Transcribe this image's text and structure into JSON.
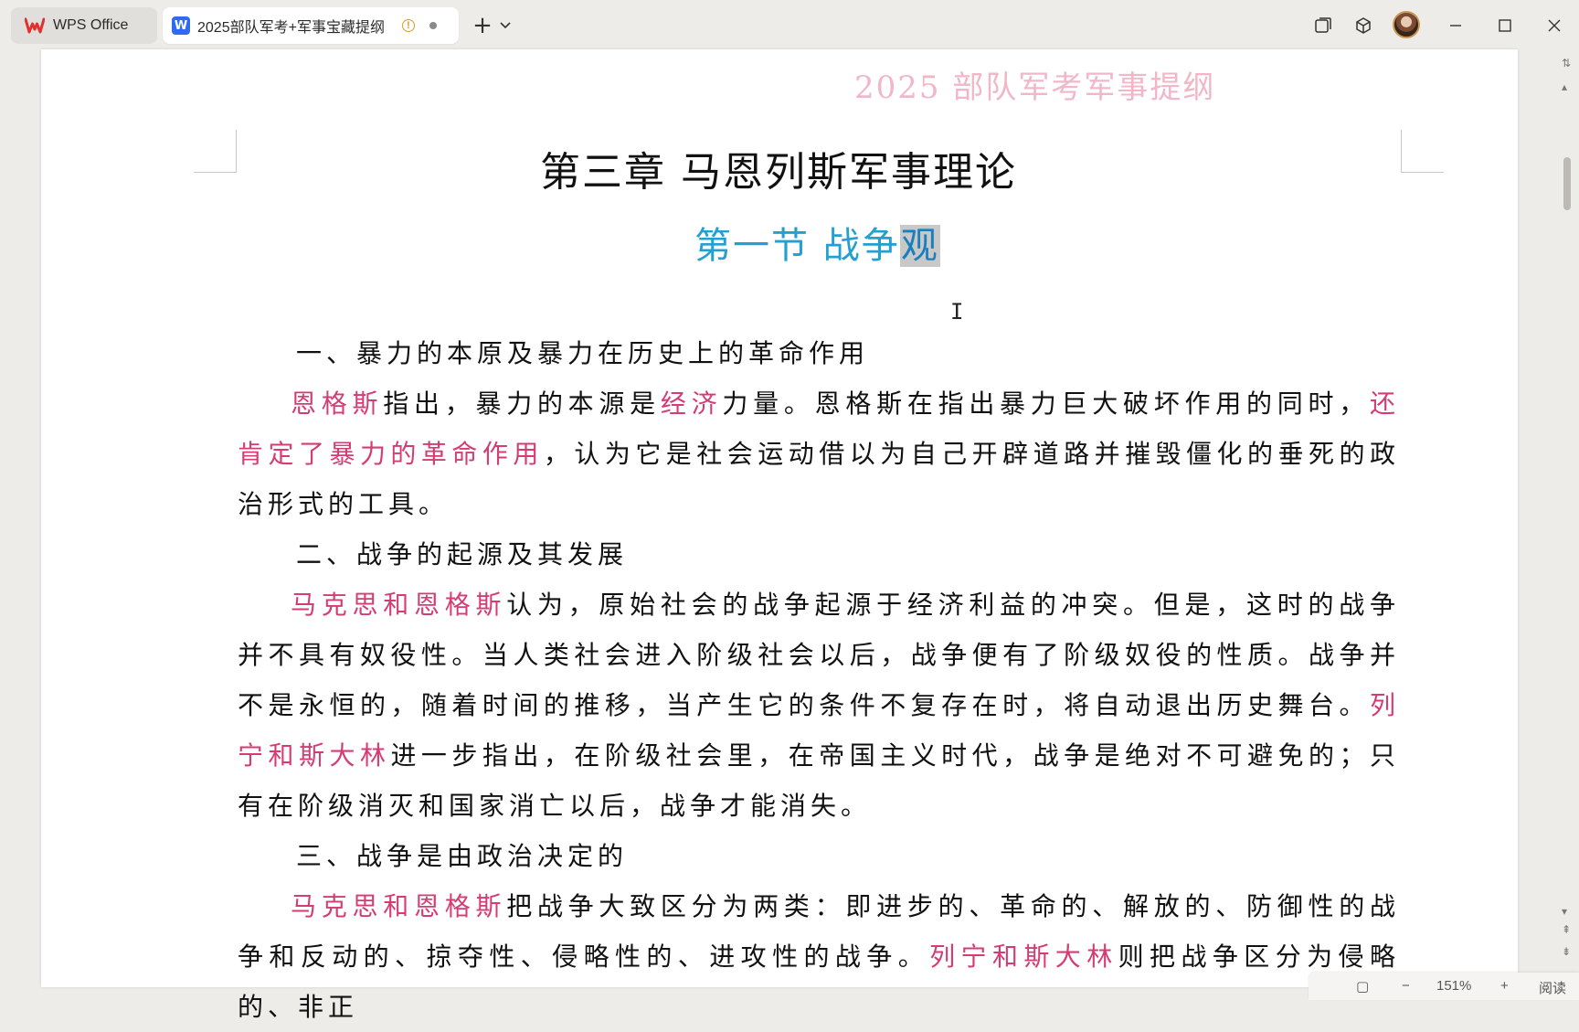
{
  "window": {
    "tabs": [
      {
        "label": "WPS Office",
        "icon": "wps-logo-icon"
      },
      {
        "label": "2025部队军考+军事宝藏提纲",
        "icon": "document-icon"
      }
    ],
    "new_tab_symbol": "+",
    "colors": {
      "wps_red": "#e0312e",
      "doc_blue": "#2f6bf0",
      "warning": "#e09a25"
    }
  },
  "document": {
    "header": "2025 部队军考军事提纲",
    "chapter_title": "第三章  马恩列斯军事理论",
    "section_title_main": "第一节  战争",
    "section_title_selected": "观",
    "paragraphs": [
      {
        "type": "heading",
        "text": "一、暴力的本原及暴力在历史上的革命作用"
      },
      {
        "type": "body",
        "spans": [
          {
            "t": "恩格斯",
            "hl": true
          },
          {
            "t": "指出，暴力的本源是",
            "hl": false
          },
          {
            "t": "经济",
            "hl": true
          },
          {
            "t": "力量。恩格斯在指出暴力巨大破坏作用的同时，",
            "hl": false
          },
          {
            "t": "还肯定了暴力的革命作用",
            "hl": true
          },
          {
            "t": "，认为它是社会运动借以为自己开辟道路并摧毁僵化的垂死的政治形式的工具。",
            "hl": false
          }
        ]
      },
      {
        "type": "heading",
        "text": "二、战争的起源及其发展"
      },
      {
        "type": "body",
        "spans": [
          {
            "t": "马克思和恩格斯",
            "hl": true
          },
          {
            "t": "认为，原始社会的战争起源于经济利益的冲突。但是，这时的战争并不具有奴役性。当人类社会进入阶级社会以后，战争便有了阶级奴役的性质。战争并不是永恒的，随着时间的推移，当产生它的条件不复存在时，将自动退出历史舞台。",
            "hl": false
          },
          {
            "t": "列宁和斯大林",
            "hl": true
          },
          {
            "t": "进一步指出，在阶级社会里，在帝国主义时代，战争是绝对不可避免的；只有在阶级消灭和国家消亡以后，战争才能消失。",
            "hl": false
          }
        ]
      },
      {
        "type": "heading",
        "text": "三、战争是由政治决定的"
      },
      {
        "type": "body",
        "spans": [
          {
            "t": "马克思和恩格斯",
            "hl": true
          },
          {
            "t": "把战争大致区分为两类：即进步的、革命的、解放的、防御性的战争和反动的、掠夺性、侵略性的、进攻性的战争。",
            "hl": false
          },
          {
            "t": "列宁和斯大林",
            "hl": true
          },
          {
            "t": "则把战争区分为侵略的、非正",
            "hl": false
          }
        ]
      }
    ],
    "colors": {
      "highlight": "#d43c74",
      "section": "#23a0d0",
      "header": "#f1b7c9"
    }
  },
  "statusbar": {
    "zoom": "151%",
    "zoom_out": "−",
    "zoom_in": "+",
    "mode": "阅读"
  }
}
